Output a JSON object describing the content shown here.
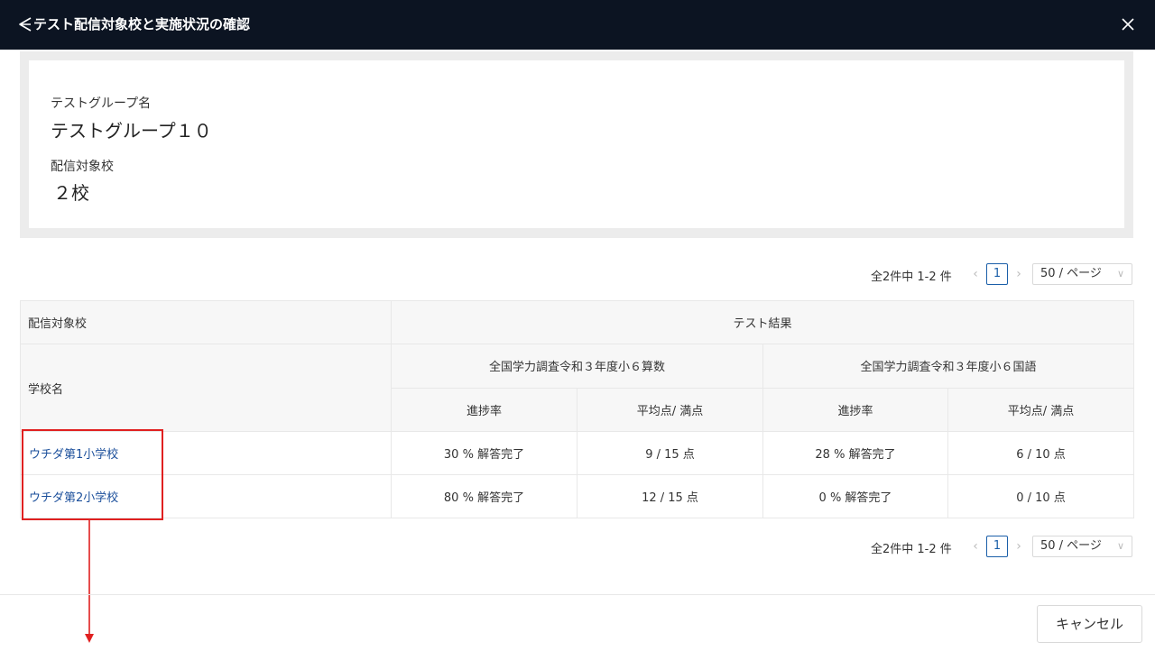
{
  "dialog": {
    "title": "テスト配信対象校と実施状況の確認",
    "back_icon": "back-icon",
    "close_icon": "close-icon",
    "close_glyph": "✕"
  },
  "info": {
    "group_label": "テストグループ名",
    "group_value": "テストグループ１０",
    "target_label": "配信対象校",
    "target_value": "２校"
  },
  "pagination": {
    "summary": "全2件中 1-2 件",
    "prev": "‹",
    "page": "1",
    "next": "›",
    "page_size": "50 / ページ",
    "chevron": "∨"
  },
  "table": {
    "col_target": "配信対象校",
    "col_results": "テスト結果",
    "col_school": "学校名",
    "tests": [
      "全国学力調査令和３年度小６算数",
      "全国学力調査令和３年度小６国語"
    ],
    "sub_progress": "進捗率",
    "sub_score": "平均点/ 満点",
    "rows": [
      {
        "school": "ウチダ第1小学校",
        "t1_progress": "30 % 解答完了",
        "t1_score": "9 / 15 点",
        "t2_progress": "28 % 解答完了",
        "t2_score": "6 / 10 点"
      },
      {
        "school": "ウチダ第2小学校",
        "t1_progress": "80 % 解答完了",
        "t1_score": "12 / 15 点",
        "t2_progress": "0 % 解答完了",
        "t2_score": "0 / 10 点"
      }
    ]
  },
  "footer": {
    "cancel_label": "キャンセル"
  },
  "colors": {
    "header_bg": "#0c1422",
    "link": "#1b4f9b",
    "highlight": "#e02020"
  }
}
